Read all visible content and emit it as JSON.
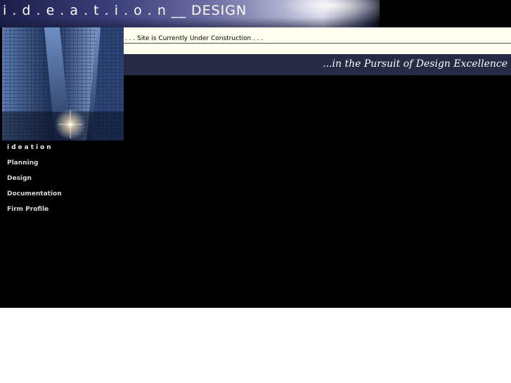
{
  "header": {
    "logo_text": "i . d . e . a . t . i . o . n __ DESIGN"
  },
  "notice": {
    "text": ". . . Site is Currently Under Construction . . ."
  },
  "tagline": {
    "text": "...in the Pursuit of Design Excellence"
  },
  "nav": {
    "items": [
      {
        "label": "ideation"
      },
      {
        "label": "Planning"
      },
      {
        "label": "Design"
      },
      {
        "label": "Documentation"
      },
      {
        "label": "Firm Profile"
      }
    ]
  },
  "colors": {
    "page_background": "#000000",
    "notice_background": "#fffff0",
    "tagline_background": "#262a44",
    "nav_text": "#d8d8d8"
  },
  "icons": {
    "hero_image": "skyscraper-photo-icon"
  }
}
